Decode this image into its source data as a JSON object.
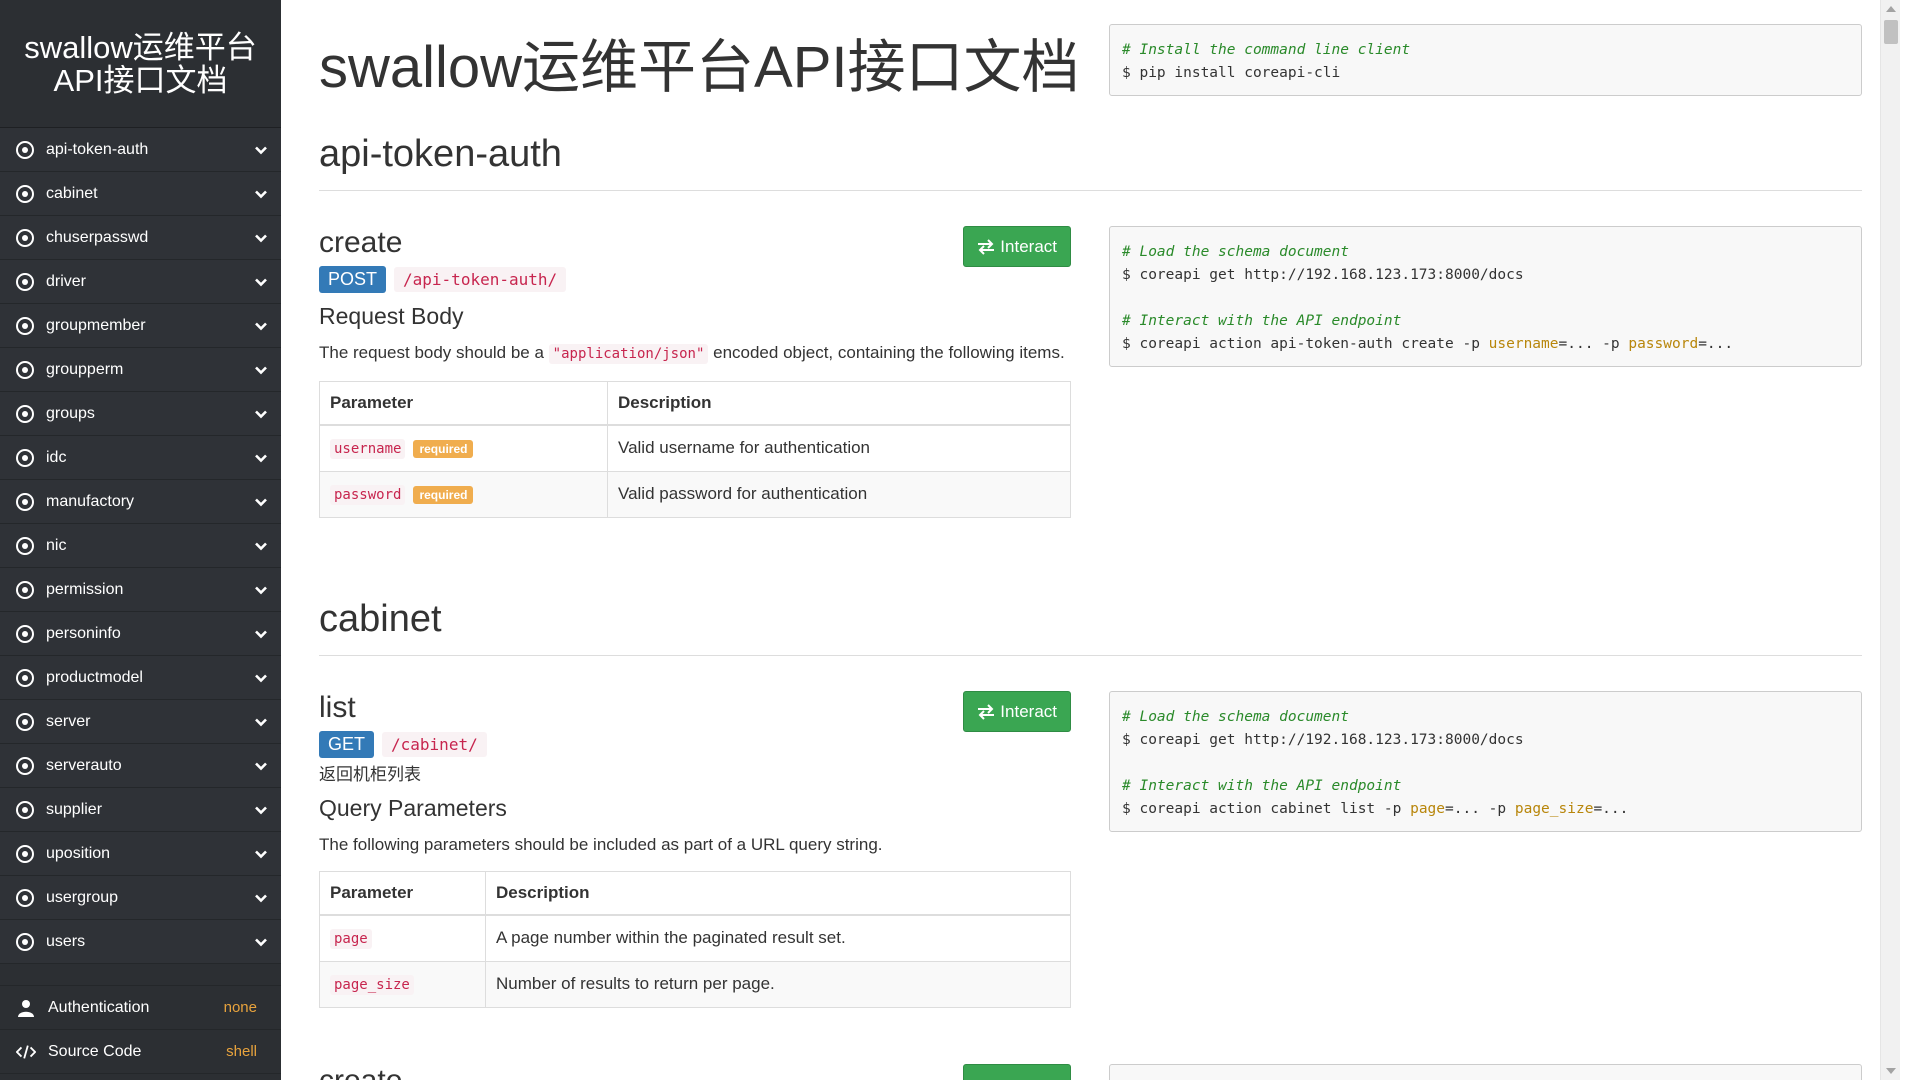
{
  "sidebar": {
    "title": "swallow运维平台API接口文档",
    "items": [
      {
        "label": "api-token-auth"
      },
      {
        "label": "cabinet"
      },
      {
        "label": "chuserpasswd"
      },
      {
        "label": "driver"
      },
      {
        "label": "groupmember"
      },
      {
        "label": "groupperm"
      },
      {
        "label": "groups"
      },
      {
        "label": "idc"
      },
      {
        "label": "manufactory"
      },
      {
        "label": "nic"
      },
      {
        "label": "permission"
      },
      {
        "label": "personinfo"
      },
      {
        "label": "productmodel"
      },
      {
        "label": "server"
      },
      {
        "label": "serverauto"
      },
      {
        "label": "supplier"
      },
      {
        "label": "uposition"
      },
      {
        "label": "usergroup"
      },
      {
        "label": "users"
      }
    ],
    "authentication": {
      "label": "Authentication",
      "value": "none"
    },
    "source_code": {
      "label": "Source Code",
      "value": "shell"
    }
  },
  "main": {
    "page_title": "swallow运维平台API接口文档",
    "install": {
      "comment": "# Install the command line client",
      "command": "$ pip install coreapi-cli"
    },
    "sections": {
      "auth": {
        "title": "api-token-auth",
        "endpoint": {
          "name": "create",
          "interact_label": "Interact",
          "method": "POST",
          "path": "/api-token-auth/",
          "body_heading": "Request Body",
          "body_text_pre": "The request body should be a ",
          "body_text_code": "\"application/json\"",
          "body_text_post": " encoded object, containing the following items.",
          "table": {
            "headers": [
              "Parameter",
              "Description"
            ],
            "rows": [
              {
                "param": "username",
                "required": "required",
                "desc": "Valid username for authentication"
              },
              {
                "param": "password",
                "required": "required",
                "desc": "Valid password for authentication"
              }
            ]
          },
          "code": {
            "c1": "# Load the schema document",
            "l1": "$ coreapi get http://192.168.123.173:8000/docs",
            "c2": "# Interact with the API endpoint",
            "l2_pre": "$ coreapi action api-token-auth create -p ",
            "l2_k1": "username",
            "l2_mid": "=... -p ",
            "l2_k2": "password",
            "l2_post": "=..."
          }
        }
      },
      "cabinet": {
        "title": "cabinet",
        "endpoint": {
          "name": "list",
          "interact_label": "Interact",
          "method": "GET",
          "path": "/cabinet/",
          "description": "返回机柜列表",
          "query_heading": "Query Parameters",
          "query_text": "The following parameters should be included as part of a URL query string.",
          "table": {
            "headers": [
              "Parameter",
              "Description"
            ],
            "rows": [
              {
                "param": "page",
                "desc": "A page number within the paginated result set."
              },
              {
                "param": "page_size",
                "desc": "Number of results to return per page."
              }
            ]
          },
          "code": {
            "c1": "# Load the schema document",
            "l1": "$ coreapi get http://192.168.123.173:8000/docs",
            "c2": "# Interact with the API endpoint",
            "l2_pre": "$ coreapi action cabinet list -p ",
            "l2_k1": "page",
            "l2_mid": "=... -p ",
            "l2_k2": "page_size",
            "l2_post": "=..."
          }
        },
        "next_endpoint": {
          "name": "create"
        }
      }
    }
  },
  "colors": {
    "sidebar_bg": "#2c2f33",
    "post_badge": "#337ab7",
    "interact_button": "#3aa652",
    "required_badge": "#f0ad4e",
    "code_path": "#c7254e"
  }
}
